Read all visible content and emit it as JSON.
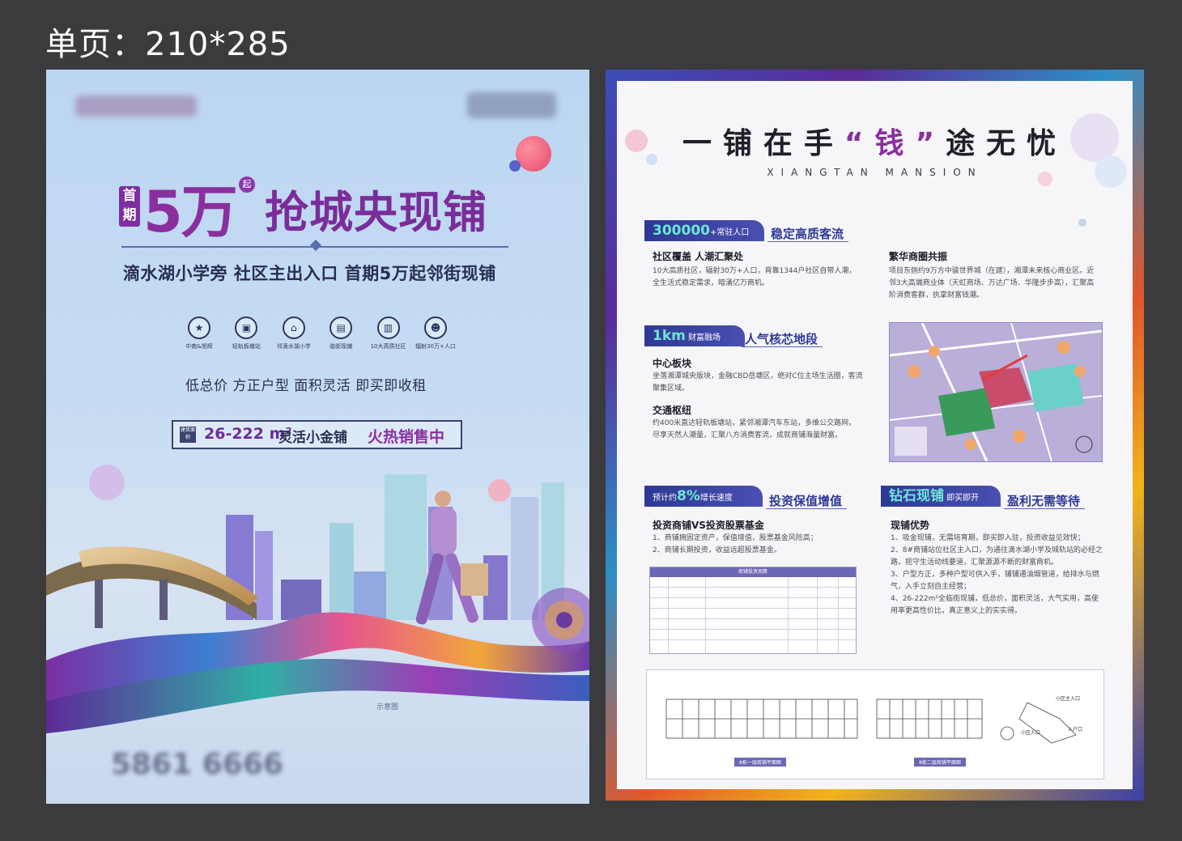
{
  "top_label": "单页：210*285",
  "front": {
    "first_badge": "首期",
    "big_price": "5万",
    "qi_mark": "起",
    "headline": "抢城央现铺",
    "subline": "滴水湖小学旁  社区主出入口  首期5万起邻街现铺",
    "features": [
      {
        "label": "中南&旭辉",
        "icon": "star-badge-icon"
      },
      {
        "label": "轻轨板塘站",
        "icon": "train-icon"
      },
      {
        "label": "邻滴水湖小学",
        "icon": "school-icon"
      },
      {
        "label": "临街现铺",
        "icon": "shop-icon"
      },
      {
        "label": "10大高质社区",
        "icon": "building-icon"
      },
      {
        "label": "辐射30万+人口",
        "icon": "people-icon"
      }
    ],
    "tagline": "低总价 方正户型 面积灵活 即买即收租",
    "sale_tag": "建筑面积",
    "sale_area": "26-222 m²",
    "sale_flex": "灵活小金铺",
    "sale_hot": "火热销售中",
    "note": "示意图",
    "phone": "5861 6666"
  },
  "back": {
    "title_a": "一铺在手",
    "title_hl": "“钱”",
    "title_b": "途无忧",
    "subtitle": "XIANGTAN MANSION",
    "sec1": {
      "pill_num": "300000",
      "pill_text": "+常驻人口",
      "title": "稳定高质客流",
      "left_head": "社区覆盖 人潮汇聚处",
      "left_body": "10大高质社区，辐射30万+人口，背靠1344户社区自带人潮，全生活式稳定需求，暗涌亿万商机。",
      "right_head": "繁华商圈共振",
      "right_body": "项目东侧约9万方中骏世界城（在建），湘潭未来核心商业区。近邻3大高端商业体（天虹商场、万达广场、华隆步步高），汇聚高阶消费客群，执掌财富钱潮。"
    },
    "sec2": {
      "pill_num": "1km",
      "pill_text": "财富融场",
      "title": "人气核芯地段",
      "head1": "中心板块",
      "body1": "坐落湘潭城央版块，金融CBD岳塘区，绝对C位主场生活圈，客流聚集区域。",
      "head2": "交通枢纽",
      "body2": "约400米直达轻轨板塘站，紧邻湘潭汽车东站，多维公交路网，尽享天然人潮量，汇聚八方消费客流，成就商铺海量财富。"
    },
    "sec3": {
      "pill_pre": "预计约",
      "pill_num": "8%",
      "pill_text": "增长速度",
      "title": "投资保值增值",
      "head": "投资商铺VS投资股票基金",
      "body": "1、商铺拥固定资产，保值增值，股票基金风险高；\n2、商铺长期投资，收益远超股票基金。",
      "table_title": "商铺投资测算"
    },
    "sec4": {
      "pill_num": "钻石现铺",
      "pill_text": "即买即开",
      "title": "盈利无需等待",
      "head": "现铺优势",
      "body": "1、吸金现铺，无需培育期，即买即入驻，投资收益见效快；\n2、8#商铺站位社区主入口，为通往滴水湖小学及城轨站的必经之路，扼守生活动线要道，汇聚源源不断的财富商机。\n3、户型方正，多种户型可供入手，铺铺通油烟管道，给排水与燃气，入手立刻自主经营；\n4、26-222m²全临街现铺，低总价，面积灵活，大气实用，高使用率更高性价比，真正意义上的实实得。"
    },
    "plans": {
      "cap1": "8栋一层商铺平面图",
      "cap2": "8栋二层商铺平面图",
      "site_labels": [
        "小区主入口",
        "小区入口",
        "入户口"
      ]
    }
  }
}
